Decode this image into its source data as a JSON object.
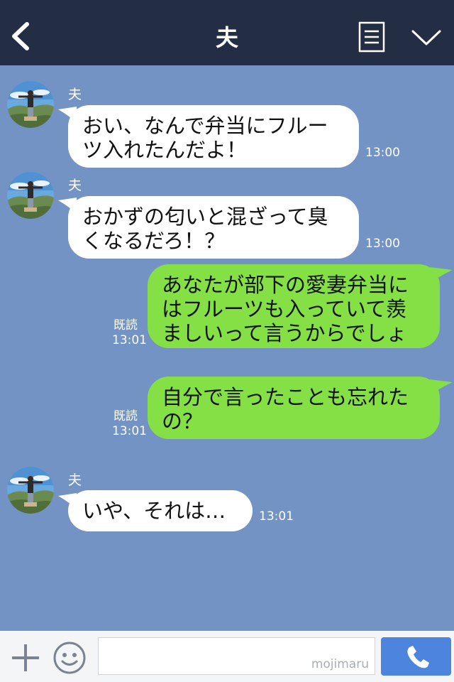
{
  "header": {
    "title": "夫"
  },
  "messages": [
    {
      "sender": "夫",
      "text": "おい、なんで弁当にフルー\nツ入れたんだよ！",
      "time": "13:00",
      "outgoing": false
    },
    {
      "sender": "夫",
      "text": "おかずの匂いと混ざって臭\nくなるだろ！？",
      "time": "13:00",
      "outgoing": false
    },
    {
      "text": "あなたが部下の愛妻弁当に\nはフルーツも入っていて羨\nましいって言うからでしょ",
      "read": "既読",
      "time": "13:01",
      "outgoing": true
    },
    {
      "text": "自分で言ったことも忘れた\nの？",
      "read": "既読",
      "time": "13:01",
      "outgoing": true
    },
    {
      "sender": "夫",
      "text": "いや、それは…",
      "time": "13:01",
      "outgoing": false
    }
  ],
  "input": {
    "watermark": "mojimaru"
  },
  "colors": {
    "header_bg": "#232e45",
    "chat_bg": "#7293c3",
    "outgoing_bubble": "#84e044",
    "call_button": "#4d84de"
  }
}
